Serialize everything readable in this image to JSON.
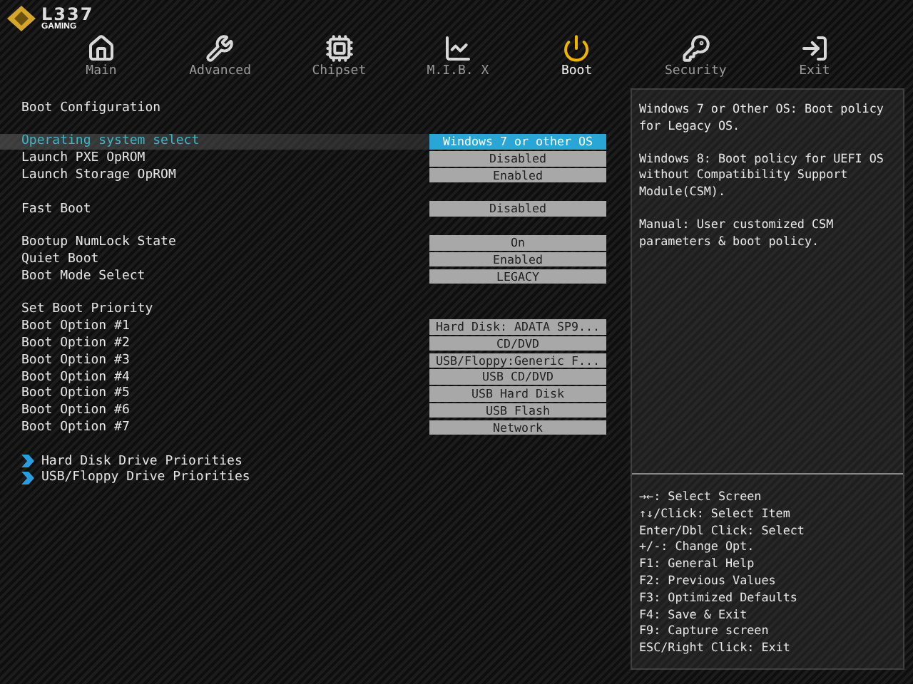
{
  "logo": {
    "name": "L337",
    "tagline": "GAMING"
  },
  "tabs": [
    {
      "label": "Main",
      "selected": false
    },
    {
      "label": "Advanced",
      "selected": false
    },
    {
      "label": "Chipset",
      "selected": false
    },
    {
      "label": "M.I.B. X",
      "selected": false
    },
    {
      "label": "Boot",
      "selected": true
    },
    {
      "label": "Security",
      "selected": false
    },
    {
      "label": "Exit",
      "selected": false
    }
  ],
  "groups": [
    {
      "items": [
        {
          "kind": "heading",
          "label": "Boot Configuration"
        }
      ]
    },
    {
      "items": [
        {
          "kind": "setting",
          "label": "Operating system select",
          "value": "Windows 7 or other OS",
          "selected": true
        },
        {
          "kind": "setting",
          "label": "Launch PXE OpROM",
          "value": "Disabled",
          "selected": false
        },
        {
          "kind": "setting",
          "label": "Launch Storage OpROM",
          "value": "Enabled",
          "selected": false
        }
      ]
    },
    {
      "items": [
        {
          "kind": "setting",
          "label": "Fast Boot",
          "value": "Disabled",
          "selected": false
        }
      ]
    },
    {
      "items": [
        {
          "kind": "setting",
          "label": "Bootup NumLock State",
          "value": "On",
          "selected": false
        },
        {
          "kind": "setting",
          "label": "Quiet Boot",
          "value": "Enabled",
          "selected": false
        },
        {
          "kind": "setting",
          "label": "Boot Mode Select",
          "value": "LEGACY",
          "selected": false
        }
      ]
    },
    {
      "items": [
        {
          "kind": "heading",
          "label": "Set Boot Priority"
        },
        {
          "kind": "setting",
          "label": "Boot Option #1",
          "value": "Hard Disk: ADATA SP9...",
          "selected": false
        },
        {
          "kind": "setting",
          "label": "Boot Option #2",
          "value": "CD/DVD",
          "selected": false
        },
        {
          "kind": "setting",
          "label": "Boot Option #3",
          "value": "USB/Floppy:Generic F...",
          "selected": false
        },
        {
          "kind": "setting",
          "label": "Boot Option #4",
          "value": "USB CD/DVD",
          "selected": false
        },
        {
          "kind": "setting",
          "label": "Boot Option #5",
          "value": "USB Hard Disk",
          "selected": false
        },
        {
          "kind": "setting",
          "label": "Boot Option #6",
          "value": "USB Flash",
          "selected": false
        },
        {
          "kind": "setting",
          "label": "Boot Option #7",
          "value": "Network",
          "selected": false
        }
      ]
    },
    {
      "items": [
        {
          "kind": "submenu",
          "label": "Hard Disk Drive Priorities"
        },
        {
          "kind": "submenu",
          "label": "USB/Floppy Drive Priorities"
        }
      ]
    }
  ],
  "help": [
    "Windows 7 or Other OS: Boot policy for Legacy OS.",
    "Windows 8: Boot policy for UEFI OS without Compatibility Support Module(CSM).",
    "Manual: User customized CSM parameters & boot policy."
  ],
  "keys": [
    "→←: Select Screen",
    "↑↓/Click: Select Item",
    "Enter/Dbl Click: Select",
    "+/-: Change Opt.",
    "F1: General Help",
    "F2: Previous Values",
    "F3: Optimized Defaults",
    "F4: Save & Exit",
    "F9: Capture screen",
    "ESC/Right Click: Exit"
  ]
}
